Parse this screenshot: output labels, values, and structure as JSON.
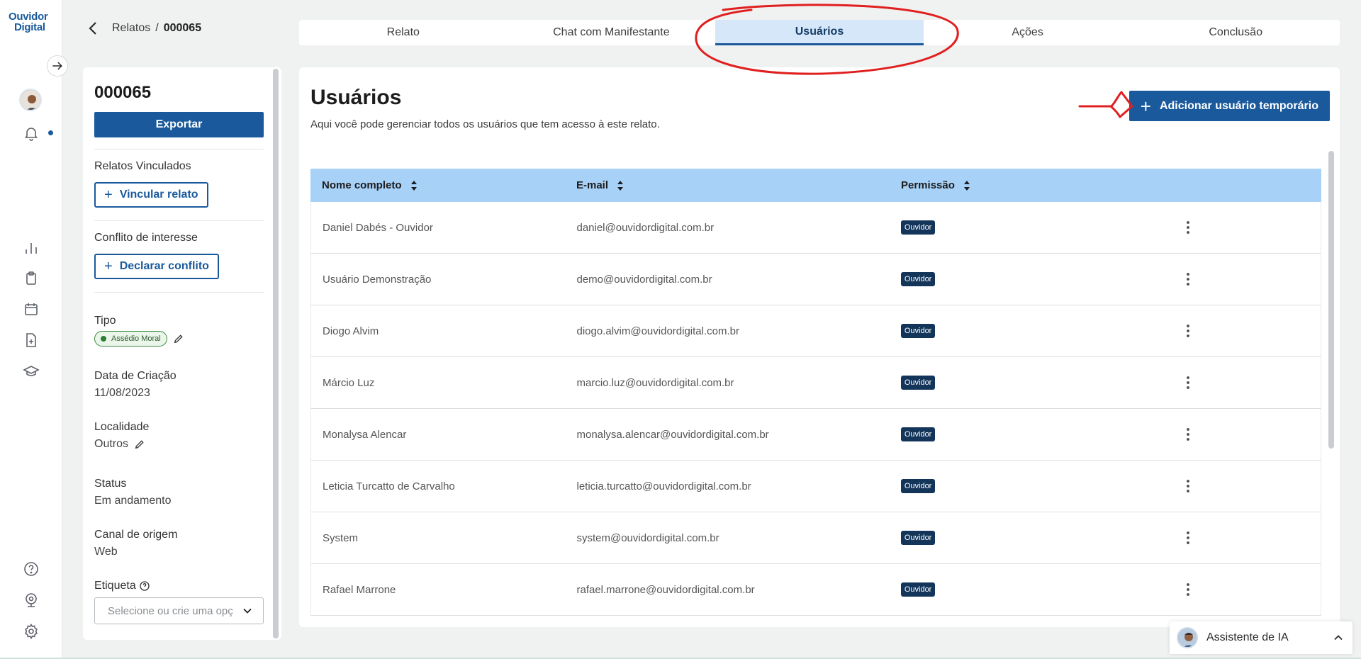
{
  "app": {
    "logo_line1": "Ouvidor",
    "logo_line2": "Digital"
  },
  "breadcrumb": {
    "parent": "Relatos",
    "separator": "/",
    "current": "000065"
  },
  "tabs": [
    {
      "label": "Relato",
      "active": false
    },
    {
      "label": "Chat com Manifestante",
      "active": false
    },
    {
      "label": "Usuários",
      "active": true
    },
    {
      "label": "Ações",
      "active": false
    },
    {
      "label": "Conclusão",
      "active": false
    }
  ],
  "sidebar_panel": {
    "report_id": "000065",
    "export_label": "Exportar",
    "linked_reports_label": "Relatos Vinculados",
    "link_report_button": "Vincular relato",
    "conflict_label": "Conflito de interesse",
    "declare_conflict_button": "Declarar conflito",
    "type_label": "Tipo",
    "type_value": "Assédio Moral",
    "creation_date_label": "Data de Criação",
    "creation_date_value": "11/08/2023",
    "location_label": "Localidade",
    "location_value": "Outros",
    "status_label": "Status",
    "status_value": "Em andamento",
    "channel_label": "Canal de origem",
    "channel_value": "Web",
    "tag_label": "Etiqueta",
    "tag_placeholder": "Selecione ou crie uma opç"
  },
  "main": {
    "title": "Usuários",
    "subtitle": "Aqui você pode gerenciar todos os usuários que tem acesso à este relato.",
    "add_button": "Adicionar usuário temporário",
    "table": {
      "columns": [
        "Nome completo",
        "E-mail",
        "Permissão"
      ],
      "rows": [
        {
          "name": "Daniel Dabés - Ouvidor",
          "email": "daniel@ouvidordigital.com.br",
          "permission": "Ouvidor"
        },
        {
          "name": "Usuário Demonstração",
          "email": "demo@ouvidordigital.com.br",
          "permission": "Ouvidor"
        },
        {
          "name": "Diogo Alvim",
          "email": "diogo.alvim@ouvidordigital.com.br",
          "permission": "Ouvidor"
        },
        {
          "name": "Márcio Luz",
          "email": "marcio.luz@ouvidordigital.com.br",
          "permission": "Ouvidor"
        },
        {
          "name": "Monalysa Alencar",
          "email": "monalysa.alencar@ouvidordigital.com.br",
          "permission": "Ouvidor"
        },
        {
          "name": "Leticia Turcatto de Carvalho",
          "email": "leticia.turcatto@ouvidordigital.com.br",
          "permission": "Ouvidor"
        },
        {
          "name": "System",
          "email": "system@ouvidordigital.com.br",
          "permission": "Ouvidor"
        },
        {
          "name": "Rafael Marrone",
          "email": "rafael.marrone@ouvidordigital.com.br",
          "permission": "Ouvidor"
        }
      ]
    }
  },
  "assistant": {
    "label": "Assistente de IA"
  },
  "colors": {
    "primary": "#1a5a9c",
    "table_header": "#a7d1f7",
    "badge": "#14355a",
    "annotation": "#e02020"
  },
  "icons": [
    "back-arrow-icon",
    "expand-arrow-icon",
    "bell-icon",
    "chart-icon",
    "clipboard-icon",
    "calendar-icon",
    "file-add-icon",
    "graduation-cap-icon",
    "help-icon",
    "webcam-icon",
    "gear-icon",
    "sort-icon",
    "kebab-menu-icon",
    "pencil-icon",
    "chevron-down-icon",
    "chevron-up-icon"
  ]
}
